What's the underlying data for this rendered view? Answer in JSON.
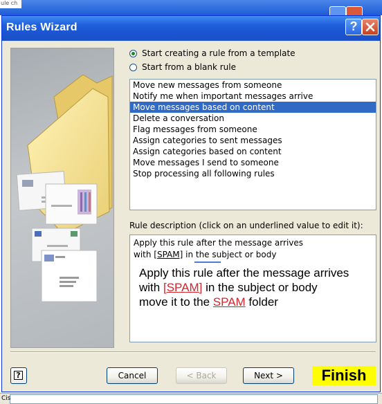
{
  "background": {
    "top_fragment": "ule ch",
    "bottom_fragment": "Cis"
  },
  "window": {
    "title": "Rules Wizard",
    "help_button_label": "?",
    "close_button_label": "X"
  },
  "options": {
    "template_label": "Start creating a rule from a template",
    "blank_label": "Start from a blank rule",
    "selected": "template"
  },
  "templates": [
    "Move new messages from someone",
    "Notify me when important messages arrive",
    "Move messages based on content",
    "Delete a conversation",
    "Flag messages from someone",
    "Assign categories to sent messages",
    "Assign categories based on content",
    "Move messages I send to someone",
    "Stop processing all following rules"
  ],
  "selected_template_index": 2,
  "description": {
    "label": "Rule description (click on an underlined value to edit it):",
    "line1": "Apply this rule after the message arrives",
    "line2_prefix": "with ",
    "line2_link": "[SPAM]",
    "line2_suffix": " in the subject or body",
    "annotation": {
      "line1": "Apply this rule after the message arrives",
      "line2_prefix": "with ",
      "line2_link": "[SPAM]",
      "line2_suffix": " in the subject or body",
      "line3_prefix": "move it to the ",
      "line3_link": "SPAM",
      "line3_suffix": " folder"
    }
  },
  "buttons": {
    "help": "?",
    "cancel": "Cancel",
    "back": "< Back",
    "next": "Next >",
    "finish": "Finish"
  },
  "colors": {
    "titlebar": "#2160dc",
    "selection": "#316ac5",
    "link_red": "#d4242a",
    "finish_highlight": "#ffff00",
    "dialog_bg": "#ece9d8"
  }
}
